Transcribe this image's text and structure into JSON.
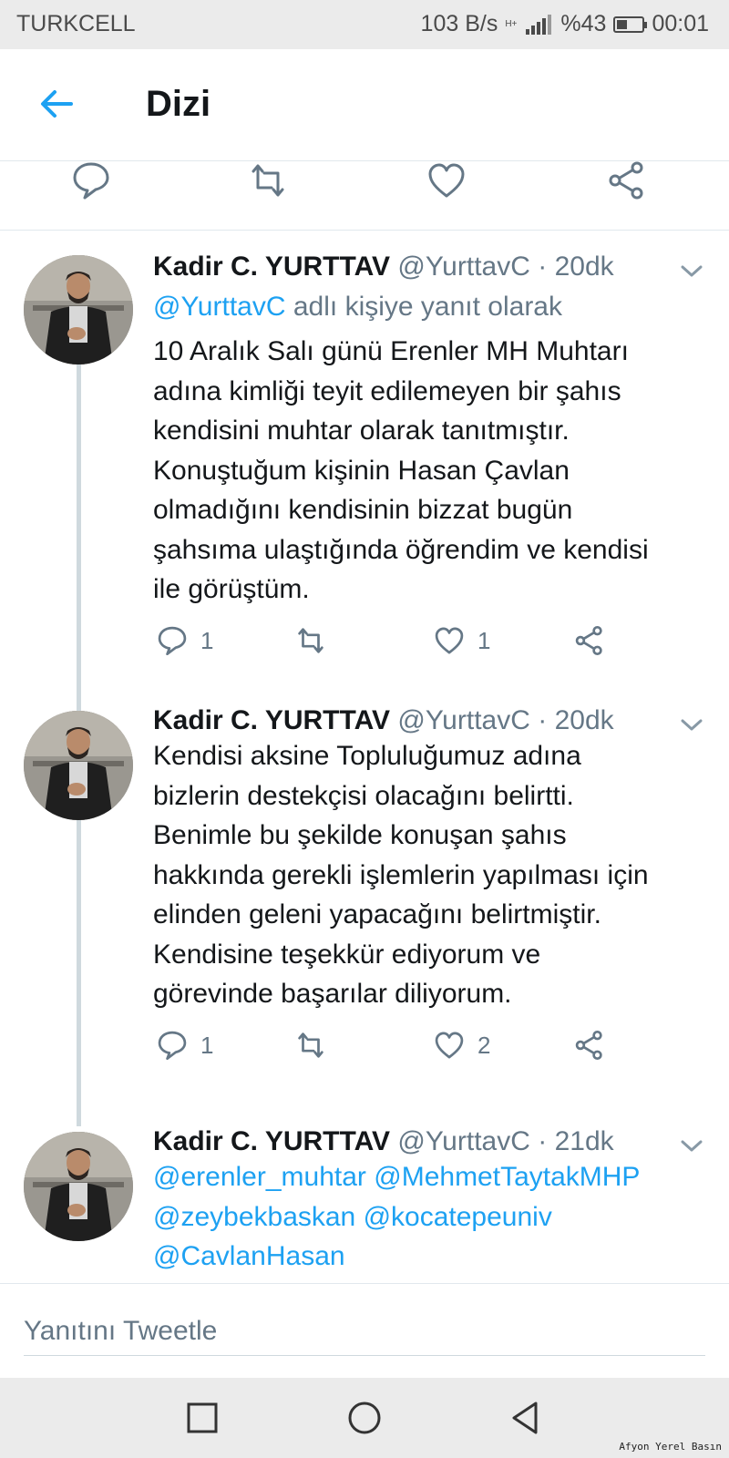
{
  "status_bar": {
    "carrier": "TURKCELL",
    "network_speed": "103 B/s",
    "network_type": "H+",
    "battery": "%43",
    "battery_level": 0.43,
    "time": "00:01"
  },
  "header": {
    "title": "Dizi",
    "back_icon": "arrow-left-icon"
  },
  "colors": {
    "accent": "#1da1f2",
    "secondary_text": "#657786",
    "primary_text": "#14171a",
    "divider": "#e1e8ed"
  },
  "tweets": [
    {
      "name": "Kadir C. YURTTAV",
      "handle": "@YurttavC",
      "sep": "·",
      "time": "20dk",
      "reply_to_handle": "@YurttavC",
      "reply_to_suffix": "adlı kişiye yanıt olarak",
      "lines": [
        "10 Aralık Salı günü Erenler MH Muhtarı",
        "adına kimliği teyit edilemeyen bir şahıs",
        "kendisini muhtar olarak tanıtmıştır.",
        "Konuştuğum kişinin Hasan Çavlan",
        "olmadığını kendisinin bizzat bugün",
        "şahsıma ulaştığında öğrendim ve kendisi",
        "ile görüştüm."
      ],
      "reply_count": "1",
      "like_count": "1"
    },
    {
      "name": "Kadir C. YURTTAV",
      "handle": "@YurttavC",
      "sep": "·",
      "time": "20dk",
      "lines": [
        "Kendisi aksine Topluluğumuz adına",
        "bizlerin destekçisi olacağını belirtti.",
        "Benimle bu şekilde konuşan şahıs",
        "hakkında gerekli işlemlerin yapılması için",
        "elinden geleni yapacağını belirtmiştir.",
        "Kendisine teşekkür ediyorum ve",
        "görevinde başarılar diliyorum."
      ],
      "reply_count": "1",
      "like_count": "2"
    },
    {
      "name": "Kadir C. YURTTAV",
      "handle": "@YurttavC",
      "sep": "·",
      "time": "21dk",
      "mentions_line1": [
        "@erenler_muhtar",
        "@MehmetTaytakMHP"
      ],
      "mentions_line2": [
        "@zeybekbaskan",
        "@kocatepeuniv"
      ],
      "mentions_line3": [
        "@CavlanHasan"
      ]
    }
  ],
  "compose": {
    "placeholder": "Yanıtını Tweetle"
  },
  "watermark": "Afyon Yerel Basın"
}
